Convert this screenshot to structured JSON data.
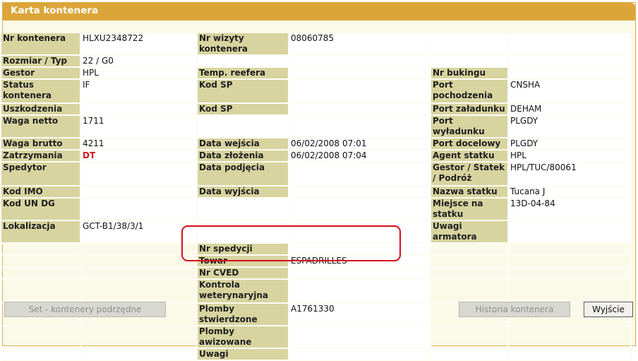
{
  "window": {
    "title": "Karta kontenera"
  },
  "colors": {
    "title_bar": "#dca53a",
    "label_bg": "#d8d4a0",
    "value_bg": "#ffffff",
    "highlight": "#d40f1c",
    "alert_text": "#d21414"
  },
  "fields": {
    "nr_kontenera": {
      "label": "Nr kontenera",
      "value": "HLXU2348722"
    },
    "nr_wizyty": {
      "label": "Nr wizyty kontenera",
      "value": "08060785"
    },
    "rozmiar_typ": {
      "label": "Rozmiar / Typ",
      "value": "22 / G0"
    },
    "gestor": {
      "label": "Gestor",
      "value": "HPL"
    },
    "temp_reefera": {
      "label": "Temp. reefera",
      "value": ""
    },
    "nr_bukingu": {
      "label": "Nr bukingu",
      "value": ""
    },
    "status_kontenera": {
      "label": "Status kontenera",
      "value": "IF"
    },
    "kod_sp_1": {
      "label": "Kod SP",
      "value": ""
    },
    "port_pochodzenia": {
      "label": "Port pochodzenia",
      "value": "CNSHA"
    },
    "uszkodzenia": {
      "label": "Uszkodzenia",
      "value": ""
    },
    "kod_sp_2": {
      "label": "Kod SP",
      "value": ""
    },
    "port_zaladunku": {
      "label": "Port załadunku",
      "value": "DEHAM"
    },
    "waga_netto": {
      "label": "Waga netto",
      "value": "1711"
    },
    "data_wejscia": {
      "label": "Data wejścia",
      "value": "06/02/2008 07:01"
    },
    "port_wyladunku": {
      "label": "Port wyładunku",
      "value": "PLGDY"
    },
    "waga_brutto": {
      "label": "Waga brutto",
      "value": "4211"
    },
    "data_zlozenia": {
      "label": "Data złożenia",
      "value": "06/02/2008 07:04"
    },
    "port_docelowy": {
      "label": "Port docelowy",
      "value": "PLGDY"
    },
    "zatrzymania": {
      "label": "Zatrzymania",
      "value": "DT"
    },
    "agent_statku": {
      "label": "Agent statku",
      "value": "HPL"
    },
    "spedytor": {
      "label": "Spedytor",
      "value": ""
    },
    "data_podjecia": {
      "label": "Data podjęcia",
      "value": ""
    },
    "gestor_statek_podroz": {
      "label": "Gestor / Statek / Podróż",
      "value": "HPL/TUC/80061"
    },
    "kod_imo": {
      "label": "Kod IMO",
      "value": ""
    },
    "data_wyjscia": {
      "label": "Data wyjścia",
      "value": ""
    },
    "nazwa_statku": {
      "label": "Nazwa statku",
      "value": "Tucana J"
    },
    "kod_un_dg": {
      "label": "Kod UN DG",
      "value": ""
    },
    "miejsce_na_statku": {
      "label": "Miejsce na statku",
      "value": "13D-04-84"
    },
    "lokalizacja": {
      "label": "Lokalizacja",
      "value": "GCT-B1/38/3/1"
    },
    "uwagi_armatora": {
      "label": "Uwagi armatora",
      "value": ""
    },
    "nr_spedycji": {
      "label": "Nr spedycji",
      "value": ""
    },
    "towar": {
      "label": "Towar",
      "value": "ESPADRILLES"
    },
    "nr_cved": {
      "label": "Nr CVED",
      "value": ""
    },
    "kontrola_weterynaryjna": {
      "label": "Kontrola weterynaryjna",
      "value": ""
    },
    "plomby_stwierdzone": {
      "label": "Plomby stwierdzone",
      "value": "A1761330"
    },
    "plomby_awizowane": {
      "label": "Plomby awizowane",
      "value": ""
    },
    "uwagi": {
      "label": "Uwagi",
      "value": ""
    }
  },
  "buttons": {
    "sub_containers": "Set - kontenery podrzędne",
    "history": "Historia kontenera",
    "exit": "Wyjście"
  }
}
